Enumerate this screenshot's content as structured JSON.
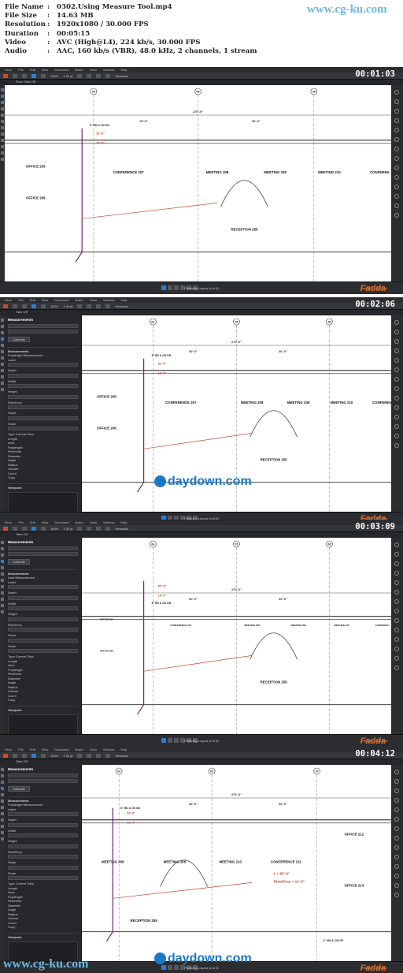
{
  "file_info": [
    {
      "key": "File Name",
      "value": "0302.Using Measure Tool.mp4"
    },
    {
      "key": "File Size",
      "value": "14.63 MB"
    },
    {
      "key": "Resolution",
      "value": "1920x1080 / 30.000 FPS"
    },
    {
      "key": "Duration",
      "value": "00:05:15"
    },
    {
      "key": "Video",
      "value": "AVC (High@L4), 224 kb/s, 30.000 FPS"
    },
    {
      "key": "Audio",
      "value": "AAC, 160 kb/s (VBR), 48.0 kHz, 2 channels, 1 stream"
    }
  ],
  "sep": ":",
  "watermark_top": "www.cg-ku.com",
  "watermark_bottom": "www.cg-ku.com",
  "daydown": "daydown.com",
  "brand": "Fadda",
  "menu": [
    "Revu",
    "File",
    "Edit",
    "View",
    "Document",
    "Batch",
    "Tools",
    "Window",
    "Help"
  ],
  "frames": [
    {
      "timestamp": "00:01:03",
      "tab": "Revu Take Off",
      "layout": "Plumbing Layout (4 of 8)",
      "scale": "42.00 x 30.00 in",
      "panel": false
    },
    {
      "timestamp": "00:02:06",
      "tab": "Take Off",
      "layout": "Plumbing Layout (4 of 8)",
      "scale": "42.00 x 30.00 in",
      "panel": true
    },
    {
      "timestamp": "00:03:09",
      "tab": "Take Off",
      "layout": "Plumbing Layout (4 of 8)",
      "scale": "42.00 x 30.00 in",
      "panel": true
    },
    {
      "timestamp": "00:04:12",
      "tab": "Take Off",
      "layout": "Plumbing Layout (4 of 8)",
      "scale": "42.00 x 30.00 in",
      "panel": true
    }
  ],
  "toolbar": {
    "zoom": "100%",
    "weight": "1.00 pt",
    "font": "Helvetica"
  },
  "panel": {
    "title": "Measurements",
    "calibrate": "Calibrate",
    "measurements": "Measurements",
    "subject": "Polylength Measurement",
    "subject3": "Area Measurement",
    "rows": [
      "Label",
      "Depth",
      "Width",
      "Height",
      "Rise/Drop",
      "Slope",
      "Scale"
    ],
    "table_head": [
      "Type",
      "Current",
      "Total"
    ],
    "table_rows": [
      "Length",
      "Area",
      "Polylength",
      "Perimeter",
      "Diameter",
      "Angle",
      "Radius",
      "Volume",
      "Count"
    ],
    "copy": "Copy",
    "viewports": "Viewports",
    "options": "Options"
  },
  "drawing": {
    "grid_labels": [
      "04",
      "05",
      "06",
      "07"
    ],
    "dims": [
      "30'-0\"",
      "270'-0\"",
      "30'-0\"",
      "30'-0\""
    ],
    "rooms_a": [
      "OFFICE 205",
      "OFFICE 206",
      "CONFERENCE 207",
      "MEETING 208",
      "MEETING 209",
      "MEETING 210",
      "CONFEREN"
    ],
    "reception": "RECEPTION 255",
    "rooms_d": [
      "MEETING 208",
      "MEETING 209",
      "MEETING 210",
      "CONFERENCE 211",
      "OFFICE 212",
      "OFFICE 213"
    ],
    "notes": [
      "6\" RD & OD DN",
      "Rise/Drop = 12'-0\"",
      "L = 95'-9\"",
      "52'-9\"",
      "16'-0\"",
      "31'-3\"",
      "13'-10\"",
      "29'-10\"",
      "1\" HW & CW UP"
    ]
  }
}
